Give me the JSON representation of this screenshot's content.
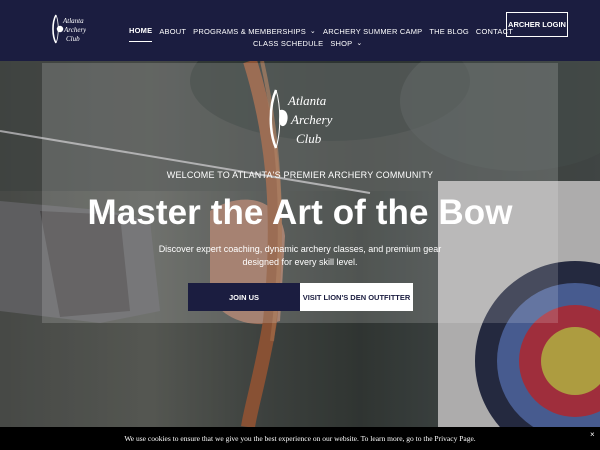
{
  "header": {
    "logo": {
      "icon": "atlanta-archery-club-logo",
      "lines": [
        "Atlanta",
        "Archery",
        "Club"
      ]
    },
    "nav_row1": [
      {
        "label": "HOME",
        "active": true
      },
      {
        "label": "ABOUT"
      },
      {
        "label": "PROGRAMS & MEMBERSHIPS",
        "dropdown": true
      },
      {
        "label": "ARCHERY SUMMER CAMP"
      },
      {
        "label": "THE BLOG"
      },
      {
        "label": "CONTACT"
      }
    ],
    "nav_row2": [
      {
        "label": "CLASS SCHEDULE"
      },
      {
        "label": "SHOP",
        "dropdown": true
      }
    ],
    "login_label": "ARCHER LOGIN"
  },
  "hero": {
    "logo": {
      "icon": "atlanta-archery-club-logo",
      "lines": [
        "Atlanta",
        "Archery",
        "Club"
      ]
    },
    "eyebrow": "WELCOME TO ATLANTA'S PREMIER ARCHERY COMMUNITY",
    "headline": "Master the Art of the Bow",
    "description": "Discover expert coaching, dynamic archery classes, and premium gear designed for every skill level.",
    "primary_button": "JOIN US",
    "secondary_button": "VISIT LION'S DEN OUTFITTER"
  },
  "cookie_bar": {
    "text": "We use cookies to ensure that we give you the best experience on our website. To learn more, go to the Privacy Page.",
    "close": "×"
  },
  "colors": {
    "navy": "#1b1d40",
    "white": "#ffffff",
    "cookie_bg": "#000000"
  }
}
